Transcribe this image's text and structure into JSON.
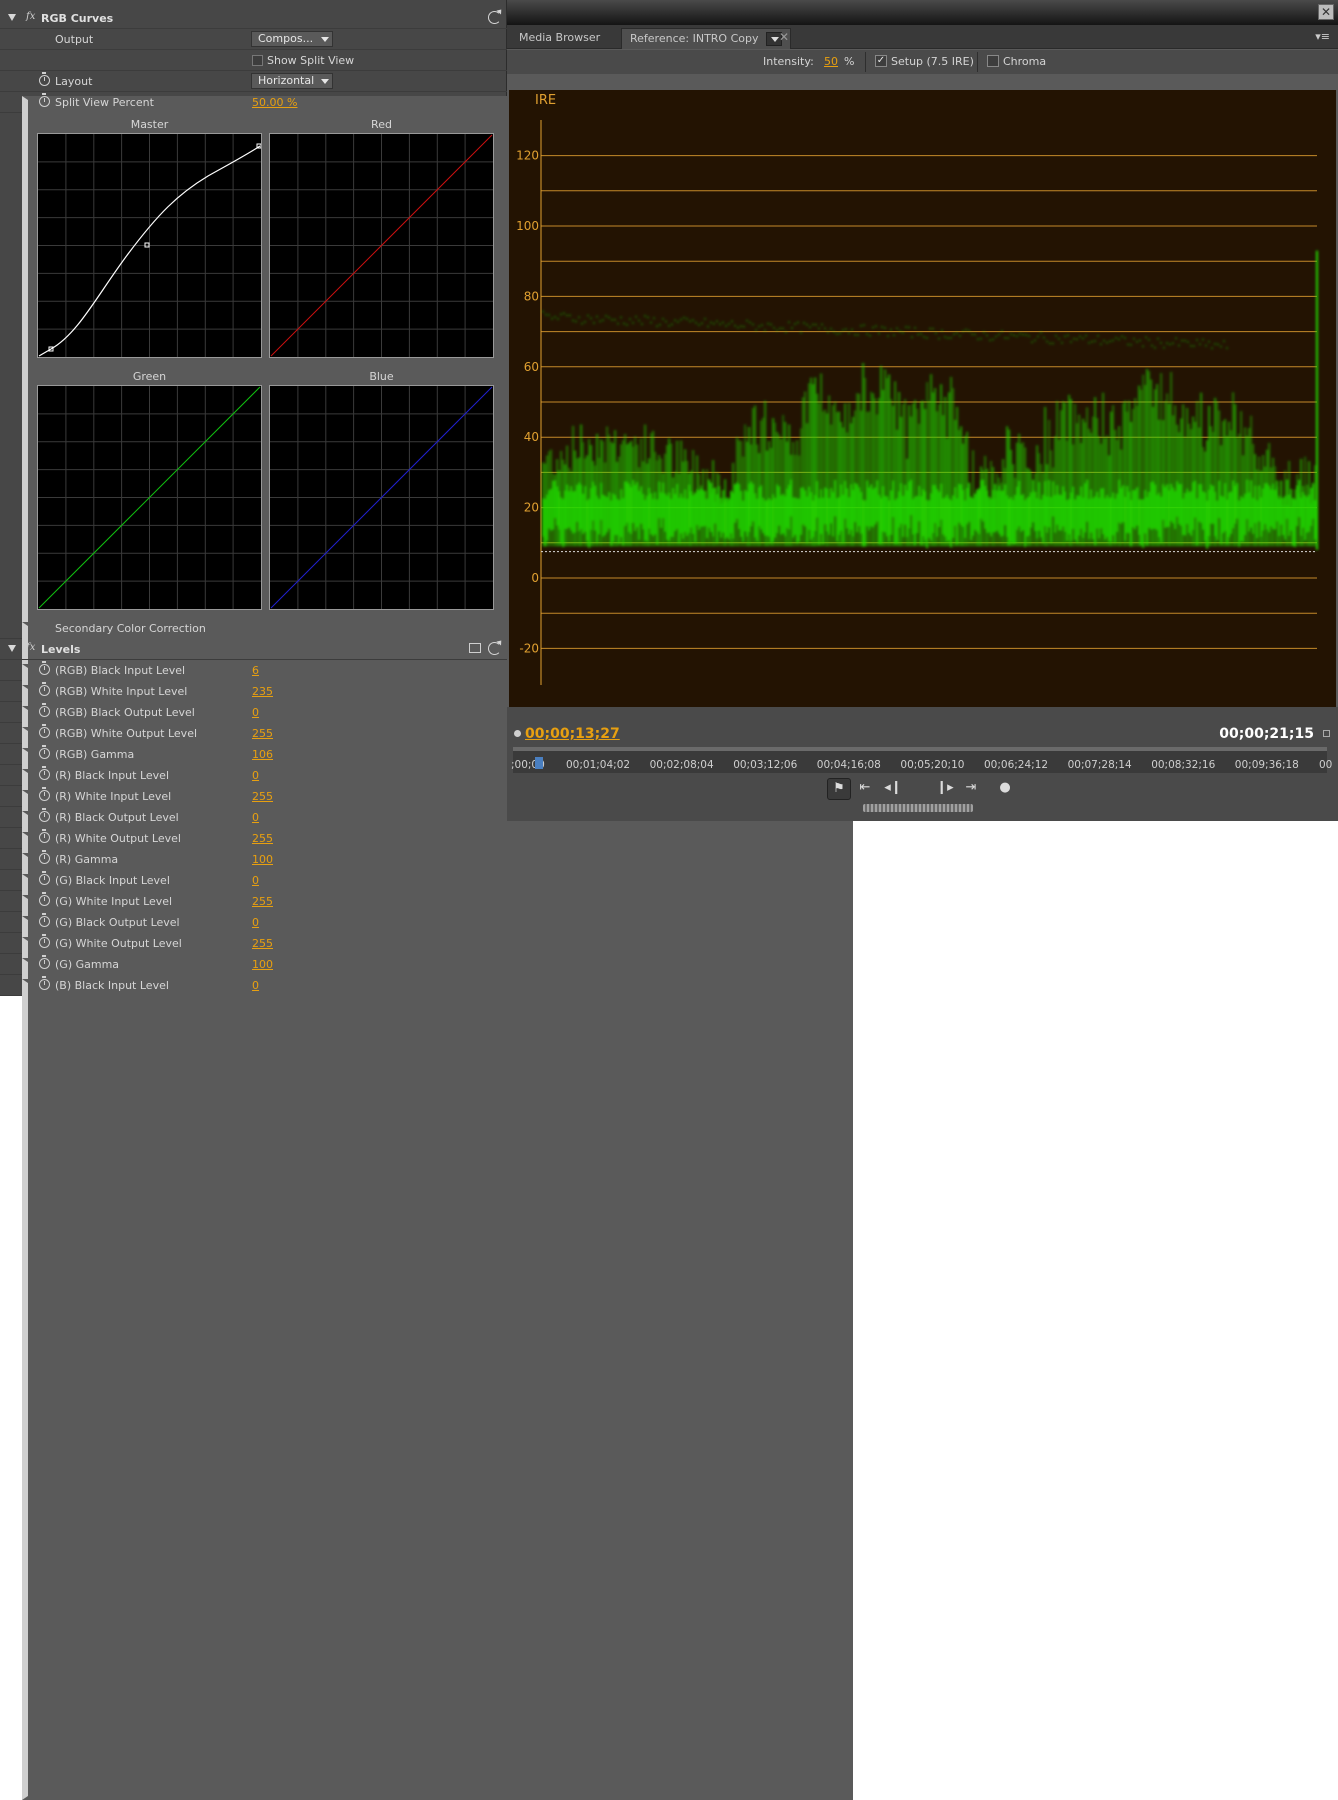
{
  "rgb_curves": {
    "title": "RGB Curves",
    "output_label": "Output",
    "output_value": "Compos...",
    "show_split_view_label": "Show Split View",
    "layout_label": "Layout",
    "layout_value": "Horizontal",
    "split_view_percent_label": "Split View Percent",
    "split_view_percent_value": "50.00 %",
    "curves": {
      "master": "Master",
      "red": "Red",
      "green": "Green",
      "blue": "Blue"
    },
    "secondary_color_correction_label": "Secondary Color Correction"
  },
  "levels": {
    "title": "Levels",
    "params": [
      {
        "label": "(RGB) Black Input Level",
        "value": "6"
      },
      {
        "label": "(RGB) White Input Level",
        "value": "235"
      },
      {
        "label": "(RGB) Black Output Level",
        "value": "0"
      },
      {
        "label": "(RGB) White Output Level",
        "value": "255"
      },
      {
        "label": "(RGB) Gamma",
        "value": "106"
      },
      {
        "label": "(R) Black Input Level",
        "value": "0"
      },
      {
        "label": "(R) White Input Level",
        "value": "255"
      },
      {
        "label": "(R) Black Output Level",
        "value": "0"
      },
      {
        "label": "(R) White Output Level",
        "value": "255"
      },
      {
        "label": "(R) Gamma",
        "value": "100"
      },
      {
        "label": "(G) Black Input Level",
        "value": "0"
      },
      {
        "label": "(G) White Input Level",
        "value": "255"
      },
      {
        "label": "(G) Black Output Level",
        "value": "0"
      },
      {
        "label": "(G) White Output Level",
        "value": "255"
      },
      {
        "label": "(G) Gamma",
        "value": "100"
      },
      {
        "label": "(B) Black Input Level",
        "value": "0"
      }
    ]
  },
  "monitor": {
    "close_glyph": "✕",
    "tabs": {
      "media_browser": "Media Browser",
      "reference": "Reference: INTRO Copy"
    },
    "tab_close_glyph": "✕",
    "panel_menu_glyph": "▾≡",
    "intensity_label": "Intensity:",
    "intensity_value": "50",
    "intensity_unit": "%",
    "setup_label": "Setup (7.5 IRE)",
    "setup_checked": true,
    "chroma_label": "Chroma",
    "chroma_checked": false,
    "scope": {
      "unit_label": "IRE",
      "axis_labels": [
        "120",
        "100",
        "80",
        "60",
        "40",
        "20",
        "0",
        "-20"
      ],
      "trace_color": "#22dd00",
      "graticule_color": "#e0a030"
    },
    "timecode_current": "00;00;13;27",
    "timecode_duration": "00;00;21;15",
    "ruler_ticks": [
      ";00;00",
      "00;01;04;02",
      "00;02;08;04",
      "00;03;12;06",
      "00;04;16;08",
      "00;05;20;10",
      "00;06;24;12",
      "00;07;28;14",
      "00;08;32;16",
      "00;09;36;18",
      "00"
    ],
    "transport_icons": [
      "marker-button-icon",
      "go-to-in-icon",
      "step-back-icon",
      "step-forward-icon",
      "go-to-out-icon",
      "output-icon"
    ]
  }
}
